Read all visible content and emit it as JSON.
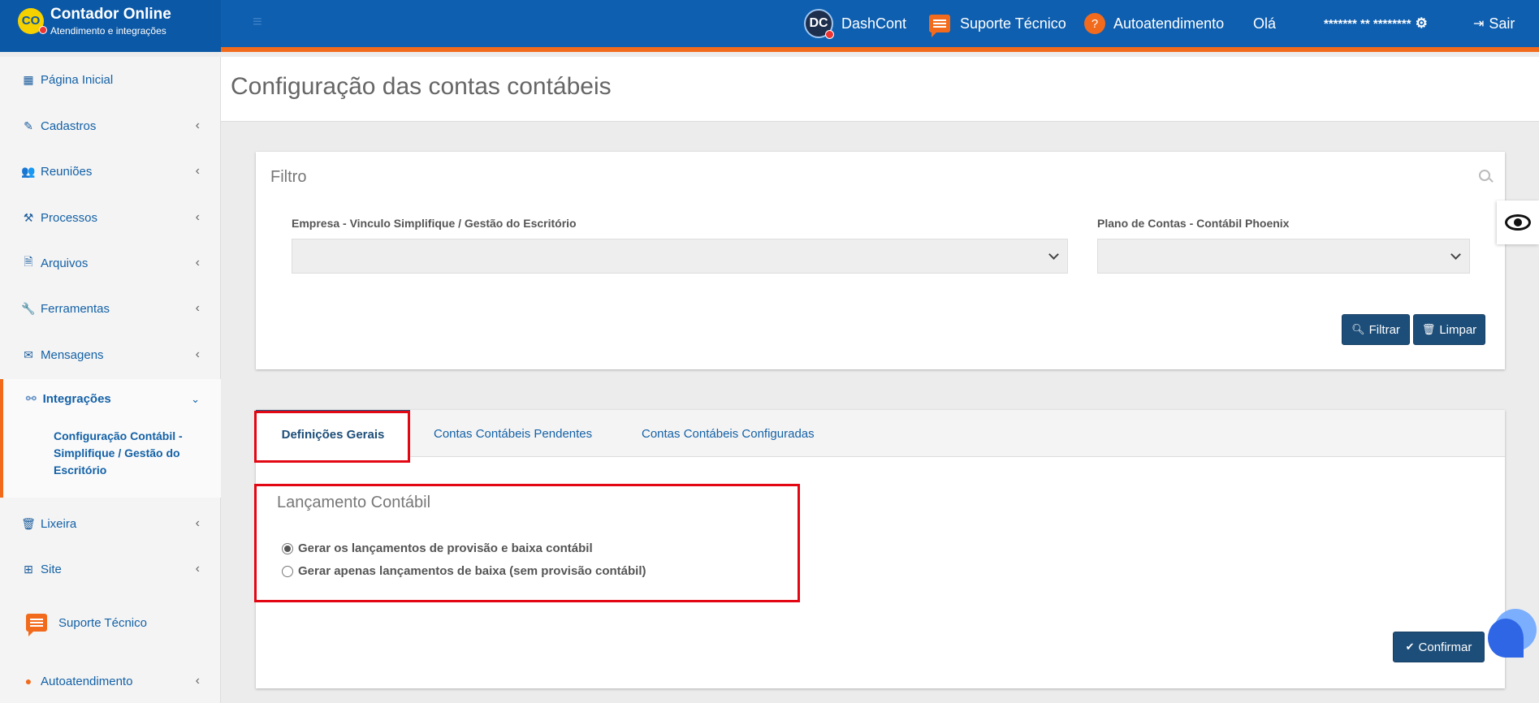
{
  "header": {
    "brand_logo": "CO",
    "brand_title": "Contador Online",
    "brand_subtitle": "Atendimento e integrações",
    "dc_logo": "DC",
    "dashcont": "DashCont",
    "suporte": "Suporte Técnico",
    "autoatendimento": "Autoatendimento",
    "greeting": "Olá",
    "user": "******* ** ********",
    "sair": "Sair"
  },
  "sidebar": {
    "items": [
      {
        "label": "Página Inicial",
        "icon": "dashboard-icon"
      },
      {
        "label": "Cadastros",
        "icon": "edit-icon"
      },
      {
        "label": "Reuniões",
        "icon": "users-icon"
      },
      {
        "label": "Processos",
        "icon": "gavel-icon"
      },
      {
        "label": "Arquivos",
        "icon": "file-icon"
      },
      {
        "label": "Ferramentas",
        "icon": "wrench-icon"
      },
      {
        "label": "Mensagens",
        "icon": "envelope-icon"
      },
      {
        "label": "Integrações",
        "icon": "plug-icon"
      },
      {
        "label": "Lixeira",
        "icon": "trash-icon"
      },
      {
        "label": "Site",
        "icon": "sitemap-icon"
      },
      {
        "label": "Autoatendimento",
        "icon": "question-icon"
      }
    ],
    "active_sub": "Configuração Contábil - Simplifique / Gestão do Escritório",
    "support": "Suporte Técnico"
  },
  "page": {
    "title": "Configuração das contas contábeis"
  },
  "filter": {
    "title": "Filtro",
    "empresa_label": "Empresa - Vinculo Simplifique / Gestão do Escritório",
    "empresa_value": "",
    "plano_label": "Plano de Contas - Contábil Phoenix",
    "plano_value": "",
    "filtrar": "Filtrar",
    "limpar": "Limpar"
  },
  "tabs": [
    "Definições Gerais",
    "Contas Contábeis Pendentes",
    "Contas Contábeis Configuradas"
  ],
  "lancamento": {
    "title": "Lançamento Contábil",
    "options": [
      {
        "label": "Gerar os lançamentos de provisão e baixa contábil",
        "checked": true
      },
      {
        "label": "Gerar apenas lançamentos de baixa (sem provisão contábil)",
        "checked": false
      }
    ],
    "confirm": "Confirmar"
  },
  "colors": {
    "header_bg": "#0e5fb0",
    "accent_orange": "#f26b1d",
    "button_dark": "#1d4e79",
    "highlight_red": "#e30613"
  }
}
